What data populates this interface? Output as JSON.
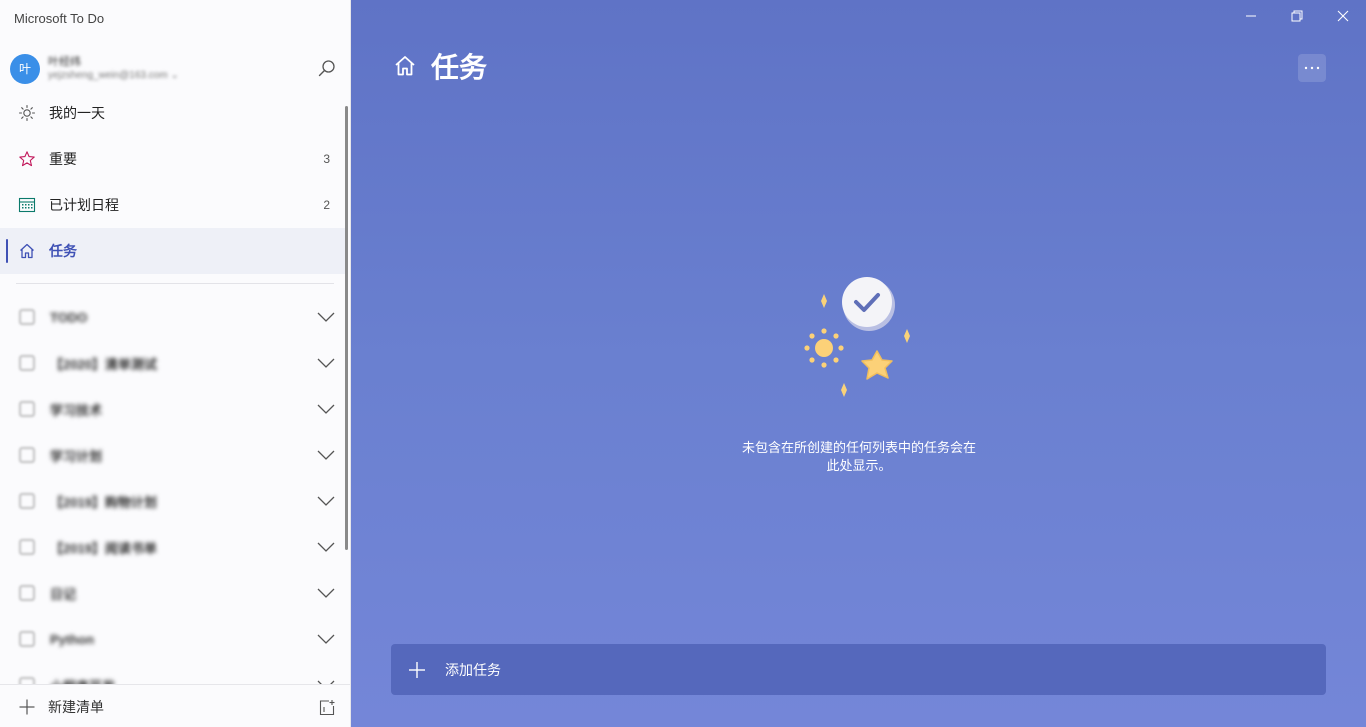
{
  "app": {
    "title": "Microsoft To Do"
  },
  "account": {
    "avatar_initial": "叶",
    "name": "叶经纬",
    "email": "yejzsheng_wein@163.com ⌄"
  },
  "nav": {
    "items": [
      {
        "label": "我的一天",
        "count": "",
        "icon": "sun-icon"
      },
      {
        "label": "重要",
        "count": "3",
        "icon": "star-icon"
      },
      {
        "label": "已计划日程",
        "count": "2",
        "icon": "calendar-icon"
      },
      {
        "label": "任务",
        "count": "",
        "icon": "home-icon"
      }
    ]
  },
  "lists": {
    "items": [
      {
        "label": "TODO"
      },
      {
        "label": "【2020】清单测试"
      },
      {
        "label": "学习技术"
      },
      {
        "label": "学习计划"
      },
      {
        "label": "【2019】购物计划"
      },
      {
        "label": "【2019】阅读书单"
      },
      {
        "label": "日记"
      },
      {
        "label": "Python"
      },
      {
        "label": "小程序开发"
      }
    ]
  },
  "footer": {
    "new_list_label": "新建清单"
  },
  "main": {
    "title": "任务",
    "empty_line1": "未包含在所创建的任何列表中的任务会在",
    "empty_line2": "此处显示。",
    "add_task_label": "添加任务"
  },
  "colors": {
    "accent": "#3f51b5",
    "main_bg_top": "#5f73c6",
    "main_bg_bottom": "#7486d8",
    "add_task_bg": "#5568bc",
    "important_star": "#c2185b",
    "calendar": "#0b7a6b"
  }
}
